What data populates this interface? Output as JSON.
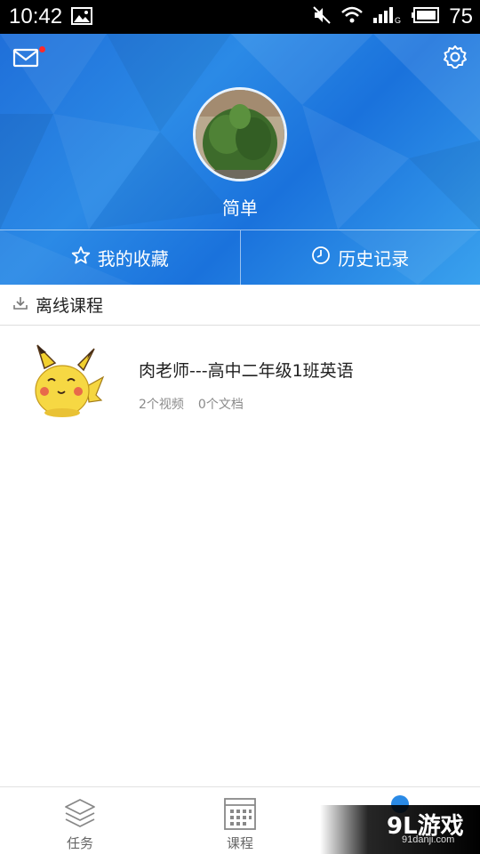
{
  "status_bar": {
    "time": "10:42",
    "battery": "75",
    "icons": [
      "image-icon",
      "mute-icon",
      "wifi-icon",
      "signal-icon",
      "battery-icon"
    ]
  },
  "header": {
    "username": "简单",
    "favorites_label": "我的收藏",
    "history_label": "历史记录",
    "icons": [
      "mail-icon",
      "settings-icon",
      "star-icon",
      "clock-icon"
    ],
    "accent_color": "#2b8ae6"
  },
  "offline": {
    "title": "离线课程",
    "icon": "download-icon"
  },
  "courses": [
    {
      "title": "肉老师---高中二年级1班英语",
      "videos": "2个视频",
      "docs": "0个文档"
    }
  ],
  "bottom_nav": {
    "items": [
      {
        "label": "任务",
        "icon": "layers-icon"
      },
      {
        "label": "课程",
        "icon": "calendar-grid-icon"
      },
      {
        "label": "",
        "icon": "profile-icon"
      }
    ]
  },
  "watermark": {
    "logo": "9L游戏",
    "url": "91danji.com"
  }
}
